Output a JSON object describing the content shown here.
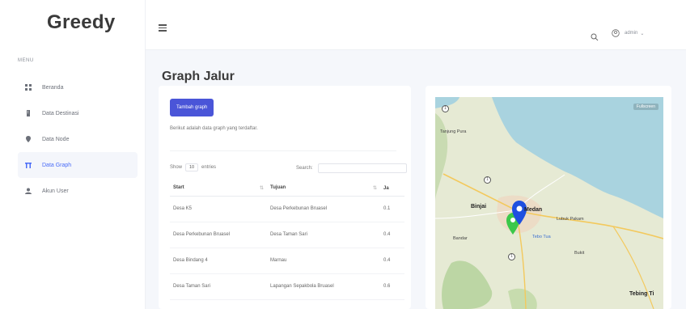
{
  "app": {
    "brand": "Greedy"
  },
  "sidebar": {
    "menu_label": "MENU",
    "items": [
      {
        "label": "Beranda",
        "icon": "grid-icon",
        "active": false
      },
      {
        "label": "Data Destinasi",
        "icon": "building-icon",
        "active": false
      },
      {
        "label": "Data Node",
        "icon": "map-pin-icon",
        "active": false
      },
      {
        "label": "Data Graph",
        "icon": "graph-icon",
        "active": true
      },
      {
        "label": "Akun User",
        "icon": "user-icon",
        "active": false
      }
    ]
  },
  "header": {
    "user_label": "admin"
  },
  "page": {
    "title": "Graph Jalur",
    "add_button": "Tambah graph",
    "description": "Berikut adalah data graph yang terdaftar.",
    "show_label": "Show",
    "show_value": "10",
    "entries_label": "entries",
    "search_label": "Search:",
    "search_value": ""
  },
  "table": {
    "columns": [
      "Start",
      "Tujuan",
      "Ja"
    ],
    "rows": [
      {
        "start": "Desa K5",
        "tujuan": "Desa Perkebunan Bruasel",
        "jarak": "0.1"
      },
      {
        "start": "Desa Perkebunan Bruasel",
        "tujuan": "Desa Taman Sari",
        "jarak": "0.4"
      },
      {
        "start": "Desa Bindang 4",
        "tujuan": "Marnau",
        "jarak": "0.4"
      },
      {
        "start": "Desa Taman Sari",
        "tujuan": "Lapangan Sepakbola Bruasel",
        "jarak": "0.6"
      }
    ]
  },
  "map": {
    "labels": {
      "tanjung": "Tanjung Pura",
      "binjai": "Binjai",
      "medan": "Medan",
      "lubuk": "Lubuk Pakam",
      "bandar": "Bandar",
      "tebing": "Tebing Ti",
      "tebo": "Tebo Tua",
      "bukit": "Bukit",
      "fullscreen": "Fullscreen"
    },
    "colors": {
      "water": "#a9d3df",
      "land": "#e8ecd8",
      "marker_blue": "#1f4fe0",
      "marker_green": "#3cc84a"
    }
  }
}
